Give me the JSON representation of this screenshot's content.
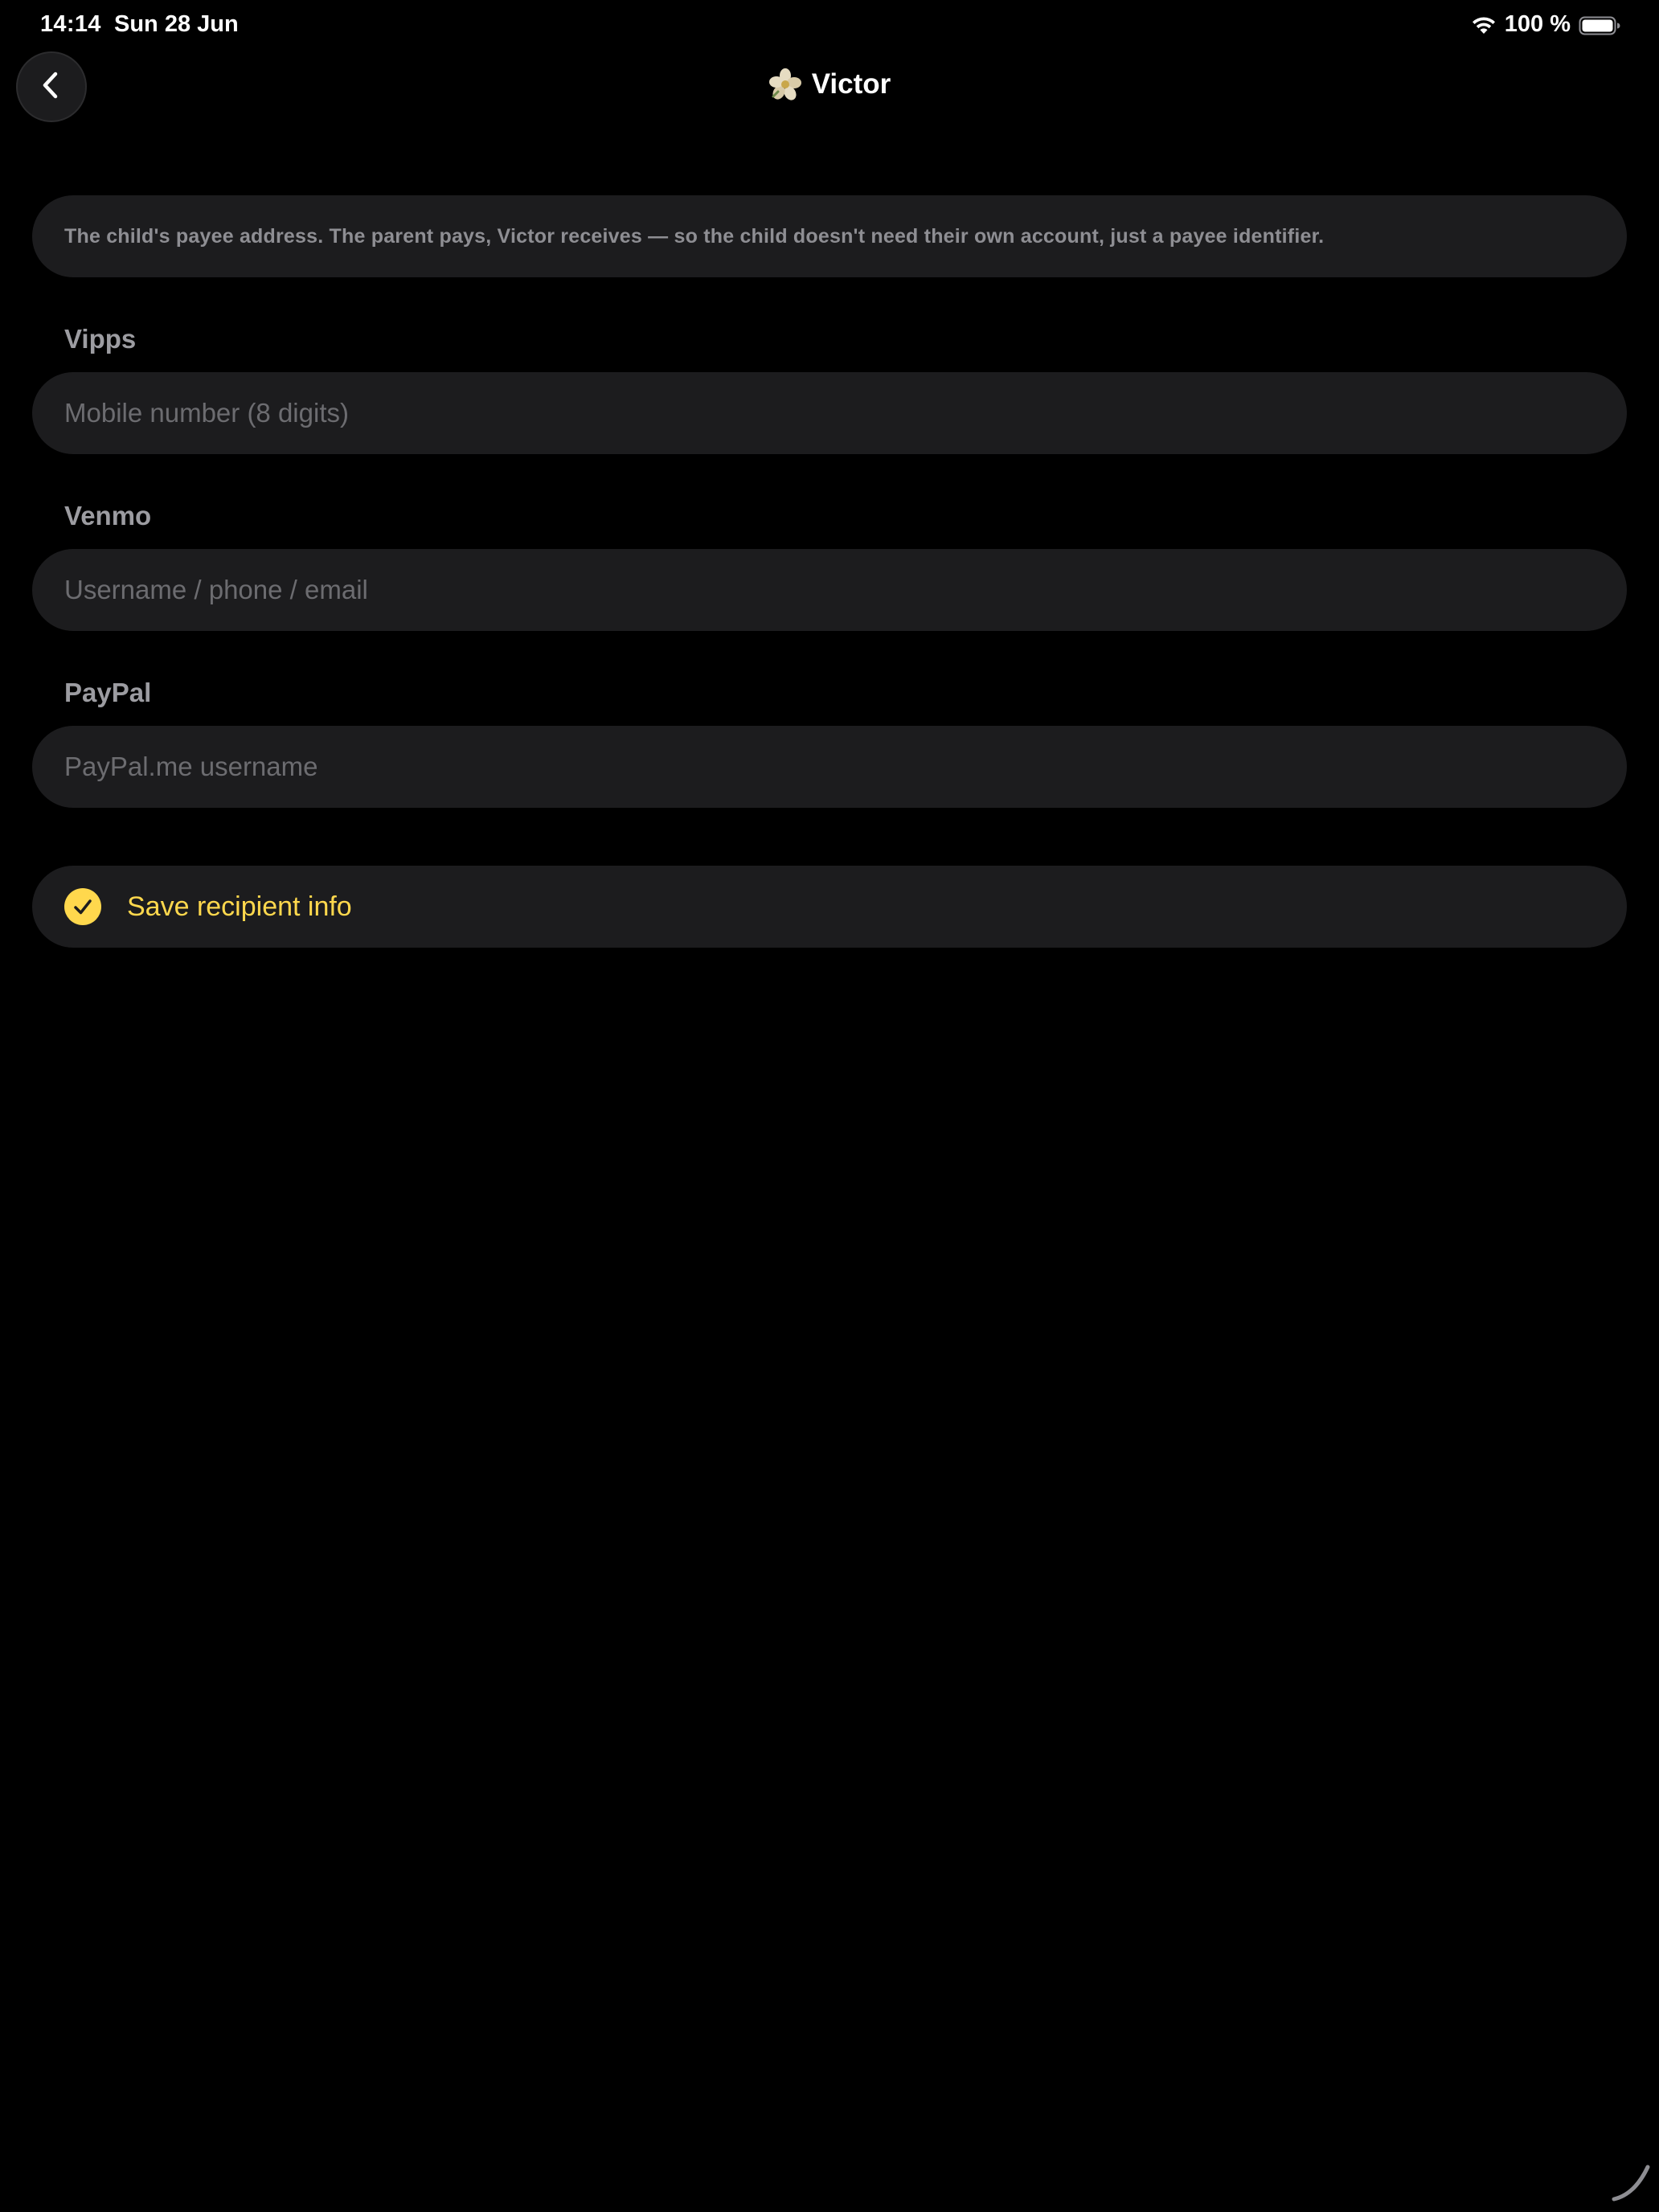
{
  "status_bar": {
    "time": "14:14",
    "date": "Sun 28 Jun",
    "battery_text": "100 %"
  },
  "header": {
    "back_icon": "chevron-left-icon",
    "avatar_icon": "flower-icon",
    "title": "Victor"
  },
  "info": {
    "text": "The child's payee address. The parent pays, Victor receives — so the child doesn't need their own account, just a payee identifier."
  },
  "fields": {
    "vipps": {
      "label": "Vipps",
      "value": "",
      "placeholder": "Mobile number (8 digits)"
    },
    "venmo": {
      "label": "Venmo",
      "value": "",
      "placeholder": "Username / phone / email"
    },
    "paypal": {
      "label": "PayPal",
      "value": "",
      "placeholder": "PayPal.me username"
    }
  },
  "save": {
    "label": "Save recipient info",
    "icon": "checkmark-circle-icon"
  },
  "colors": {
    "background": "#000000",
    "card": "#1c1c1e",
    "accent": "#ffd84d",
    "muted_text": "#8e8e93",
    "placeholder": "#6c6c70"
  }
}
